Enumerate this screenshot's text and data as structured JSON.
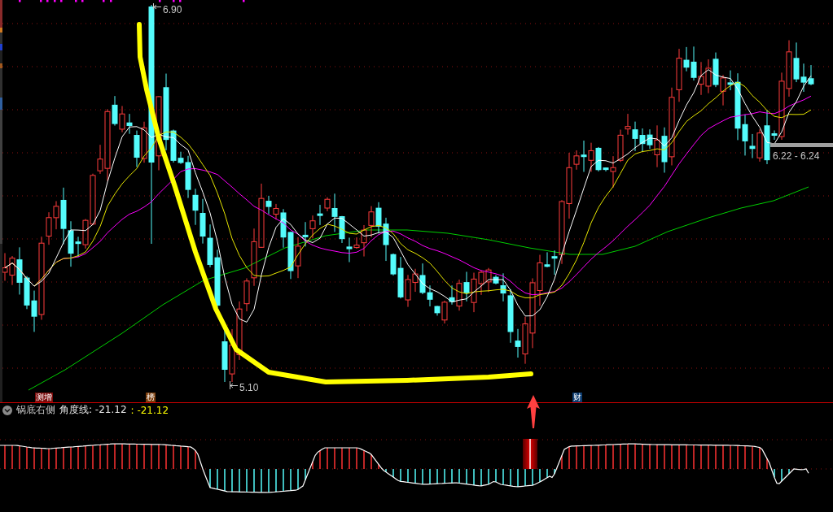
{
  "price_chart": {
    "high_label": "6.90",
    "low_label": "5.10",
    "range_label": "6.22 - 6.24",
    "event_markers": [
      {
        "label": "测增",
        "color": "#7a0a0a"
      },
      {
        "label": "榜",
        "color": "#7a3c0a"
      },
      {
        "label": "财",
        "color": "#0a3a6e"
      }
    ]
  },
  "indicator": {
    "name": "锅底右侧",
    "readings": [
      {
        "text": "角度线: -21.12",
        "color": "#e6e6e6"
      },
      {
        "text": ": -21.12",
        "color": "#ffff00"
      }
    ]
  }
}
